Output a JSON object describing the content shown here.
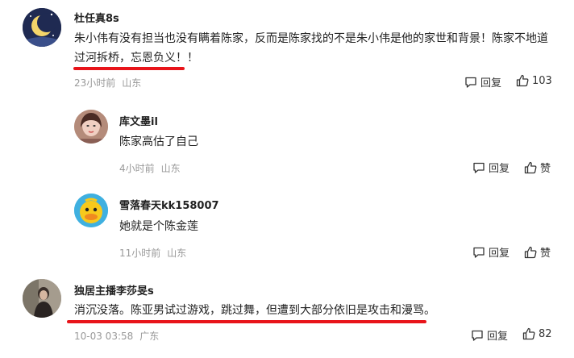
{
  "comments": [
    {
      "username": "杜任真8s",
      "text_line1": "朱小伟有没有担当也没有瞒着陈家，反而是陈家找的不是朱小伟是他的家世和背景！陈家不地道",
      "text_line2": "过河拆桥，忘恩负义！！",
      "time": "23小时前",
      "location": "山东",
      "reply_label": "回复",
      "like_count": "103"
    },
    {
      "username": "库文墨il",
      "text": "陈家高估了自己",
      "time": "4小时前",
      "location": "山东",
      "reply_label": "回复",
      "like_label": "赞"
    },
    {
      "username": "雪落春天kk158007",
      "text": "她就是个陈金莲",
      "time": "11小时前",
      "location": "山东",
      "reply_label": "回复",
      "like_label": "赞"
    },
    {
      "username": "独居主播李莎旻s",
      "text": "消沉没落。陈亚男试过游戏，跳过舞，但遭到大部分依旧是攻击和漫骂。",
      "time": "10-03 03:58",
      "location": "广东",
      "reply_label": "回复",
      "like_count": "82"
    }
  ],
  "colors": {
    "highlight_underline": "#e8141a",
    "meta_text": "#999999"
  }
}
